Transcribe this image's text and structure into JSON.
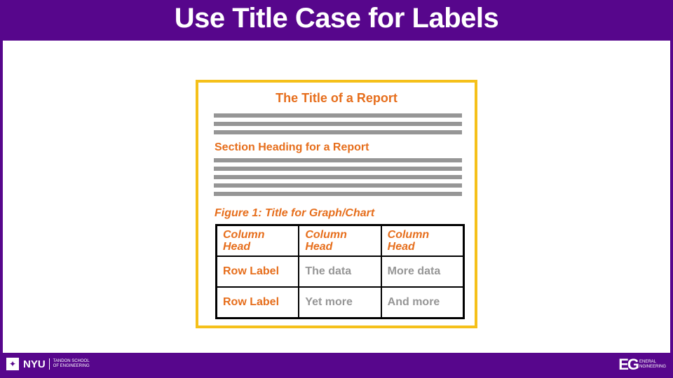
{
  "slide": {
    "title": "Use Title Case for Labels"
  },
  "document": {
    "title": "The Title of a Report",
    "section_heading": "Section Heading for a Report",
    "figure_caption": "Figure 1: Title for Graph/Chart",
    "table": {
      "headers": [
        "Column Head",
        "Column Head",
        "Column Head"
      ],
      "rows": [
        [
          "Row Label",
          "The data",
          "More data"
        ],
        [
          "Row Label",
          "Yet more",
          "And more"
        ]
      ]
    }
  },
  "footer": {
    "nyu_logo": "NYU",
    "nyu_line1": "TANDON SCHOOL",
    "nyu_line2": "OF ENGINEERING",
    "eg_logo": "EG",
    "eg_line1": "ENERAL",
    "eg_line2": "NGINEERING"
  },
  "colors": {
    "purple": "#57068c",
    "orange": "#e66e1c",
    "gold": "#f5c01a",
    "gray": "#969696"
  }
}
